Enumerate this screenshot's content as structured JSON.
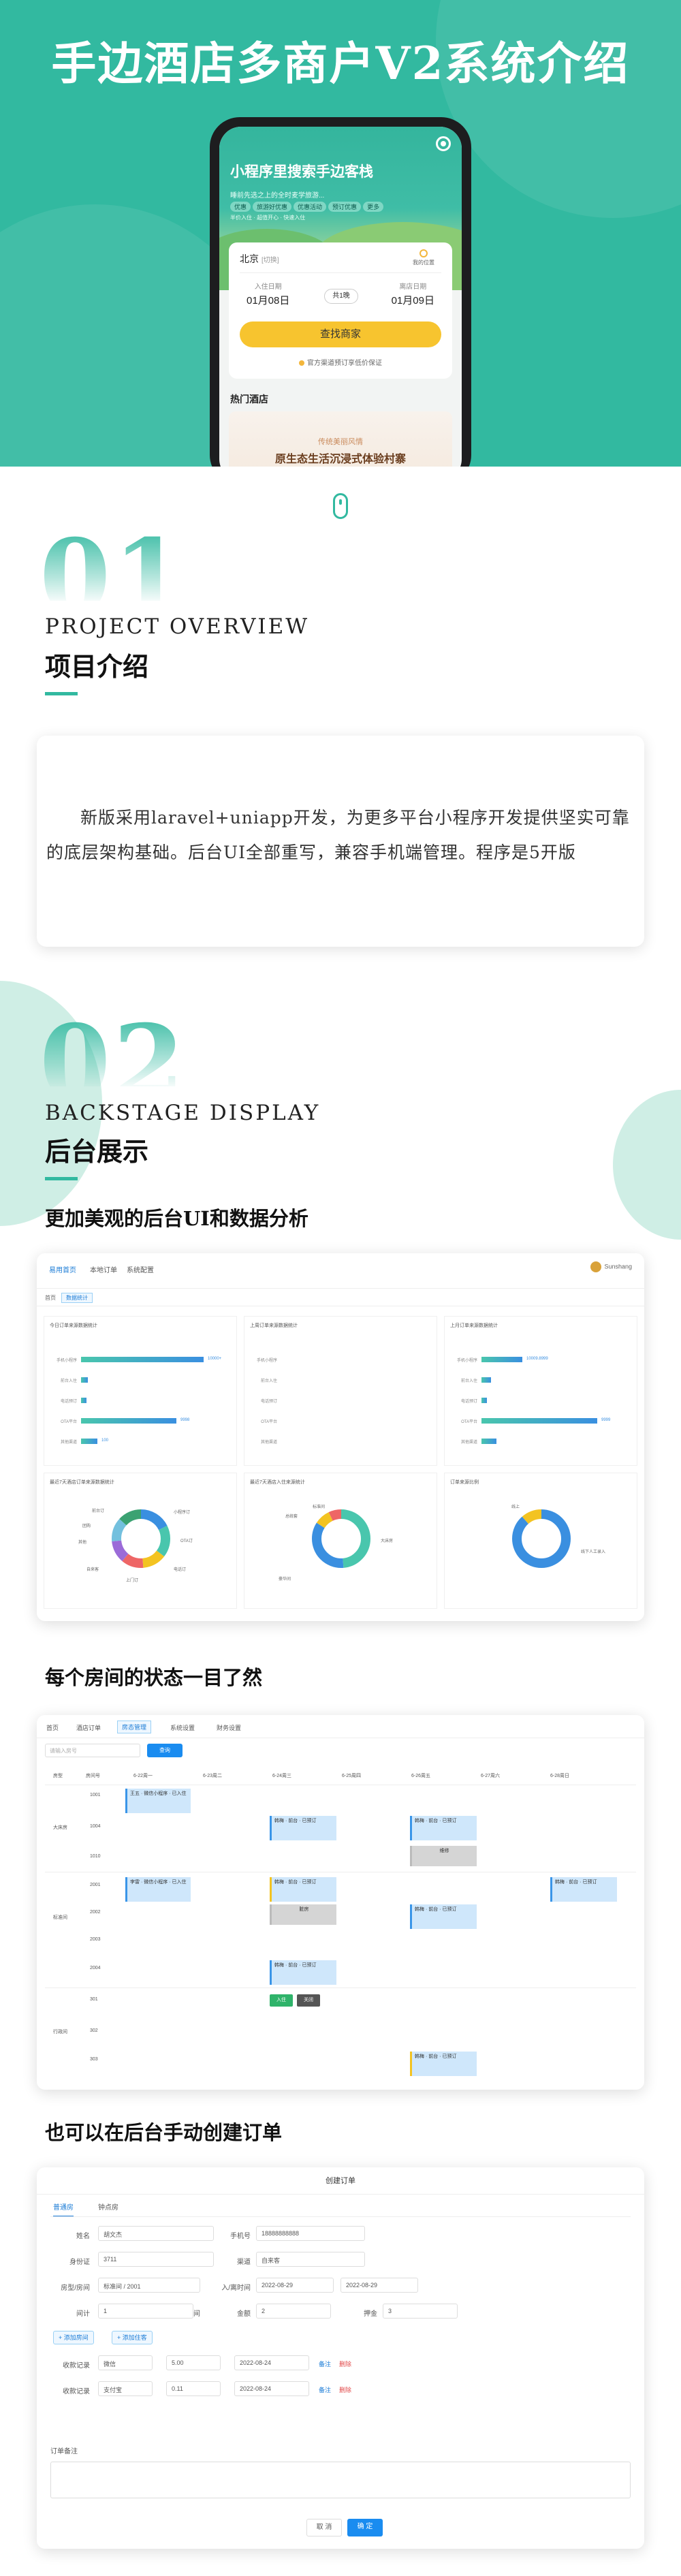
{
  "hero": {
    "title": "手边酒店多商户V2系统介绍",
    "phone": {
      "brand": "小程序里搜索手边客栈",
      "subtitle": "睡前先选之上的全时麦学旅游...",
      "tags": [
        "优惠",
        "旅游好优惠",
        "优惠活动",
        "预订优惠",
        "更多"
      ],
      "tags_line2": "半价入住 · 超值开心 · 快速入住",
      "city": "北京",
      "city_hint": "[切换]",
      "locate_label": "我的位置",
      "checkin_label": "入住日期",
      "checkin_date": "01月08日",
      "nights": "共1晚",
      "checkout_label": "离店日期",
      "checkout_date": "01月09日",
      "search_button": "查找商家",
      "guarantee": "官方渠道预订享低价保证",
      "hot_title": "热门酒店",
      "banner_small": "传统美丽风情",
      "banner_big": "原生态生活沉浸式体验村寨"
    }
  },
  "section1": {
    "number": "01",
    "en": "PROJECT OVERVIEW",
    "cn": "项目介绍",
    "text": "新版采用laravel+uniapp开发，为更多平台小程序开发提供坚实可靠的底层架构基础。后台UI全部重写，兼容手机端管理。程序是5开版"
  },
  "section2": {
    "number": "02",
    "en": "BACKSTAGE DISPLAY",
    "cn": "后台展示",
    "sub1": "更加美观的后台UI和数据分析",
    "sub2": "每个房间的状态一目了然",
    "sub3": "也可以在后台手动创建订单"
  },
  "dashboard": {
    "tabs": [
      "易用首页",
      "本地订单",
      "系统配置"
    ],
    "user": "Sunshang",
    "crumbs": [
      "首页",
      "数据统计"
    ],
    "panel_titles": [
      "今日订单来源数据统计",
      "上周订单来源数据统计",
      "上月订单来源数据统计",
      "最近7天酒店订单来源数据统计",
      "最近7天酒店入住来源统计",
      "订单来源比例"
    ],
    "bar_labels": [
      "手机小程序",
      "前台入住",
      "电话预订",
      "OTA平台",
      "其他渠道"
    ],
    "panel_a_values": [
      "10000+",
      "",
      "",
      "9998",
      "100"
    ],
    "panel_c_values": [
      "10009.8999",
      "",
      "",
      "9999",
      ""
    ],
    "donut_a_labels": [
      "前台订",
      "小程序订",
      "OTA订",
      "电话订",
      "上门订",
      "自来客",
      "其他",
      "团购"
    ],
    "donut_b_labels": [
      "标准间",
      "大床房",
      "豪华间",
      "总统套"
    ],
    "donut_c_labels": [
      "线上",
      "线下人工录入"
    ]
  },
  "roomgrid": {
    "tabs": [
      "首页",
      "酒店订单",
      "房态管理",
      "系统设置",
      "财务设置"
    ],
    "search_placeholder": "请输入房号",
    "search_button": "查询",
    "col_headers": [
      "房型",
      "房间号",
      "6-22周一",
      "6-23周二",
      "6-24周三",
      "6-25周四",
      "6-26周五",
      "6-27周六",
      "6-28周日"
    ],
    "room_types": [
      "大床房",
      "标准间",
      "行政间"
    ],
    "rooms": [
      "1001",
      "1004",
      "1010",
      "2001",
      "2002",
      "2003",
      "2004",
      "301",
      "302",
      "303"
    ],
    "booking_a": "王五 · 微信小程序 · 已入住",
    "booking_b": "李雷 · 微信小程序 · 已入住",
    "booking_c": "韩梅 · 前台 · 已预订",
    "maint": "维修",
    "dirty": "脏房",
    "checkin_btn": "入住",
    "close_btn": "关闭"
  },
  "orderform": {
    "title": "创建订单",
    "tabs": [
      "普通房",
      "钟点房"
    ],
    "name_label": "姓名",
    "name_value": "胡文杰",
    "phone_label": "手机号",
    "phone_value": "18888888888",
    "id_label": "身份证",
    "id_value": "3711",
    "channel_label": "渠道",
    "channel_value": "自来客",
    "room_label": "房型/房间",
    "room_value": "标准间 / 2001",
    "stay_label": "入/离时间",
    "stay_from": "2022-08-29",
    "stay_to": "2022-08-29",
    "count_label": "间计",
    "count_value": "1",
    "count_unit": "间",
    "amount_label": "金额",
    "amount_value": "2",
    "deposit_label": "押金",
    "deposit_value": "3",
    "add_room": "+ 添加房间",
    "add_guest": "+ 添加住客",
    "pay_label": "收款记录",
    "pay1_method": "微信",
    "pay1_amount": "5.00",
    "pay1_date": "2022-08-24",
    "pay2_method": "支付宝",
    "pay2_amount": "0.11",
    "pay2_date": "2022-08-24",
    "remark_link": "备注",
    "delete_link": "删除",
    "note_label": "订单备注",
    "cancel_button": "取 消",
    "confirm_button": "确 定"
  },
  "colors": {
    "brand_teal": "#32b9a0",
    "accent_blue": "#1a8cf0",
    "cta_yellow": "#f7c42f"
  }
}
